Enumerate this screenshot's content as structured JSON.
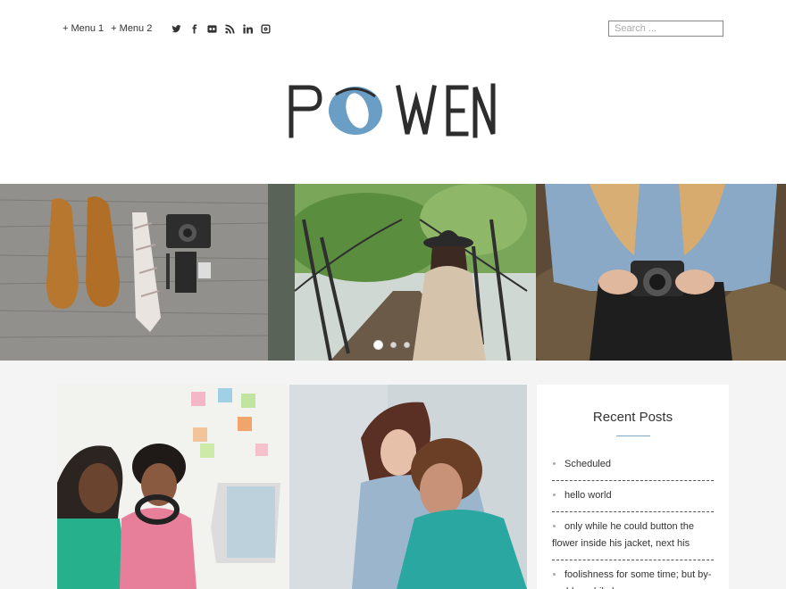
{
  "header": {
    "menu": [
      "+ Menu 1",
      "+ Menu 2"
    ],
    "social_icons": [
      "twitter-icon",
      "facebook-icon",
      "flickr-icon",
      "rss-icon",
      "linkedin-icon",
      "instagram-icon"
    ],
    "search_placeholder": "Search ...",
    "logo_text": "POWEN"
  },
  "slider": {
    "slides": [
      "shoes-tie-camera-photo",
      "woman-hat-stairs-photo",
      "woman-camera-photo"
    ],
    "active_slide": 1
  },
  "sidebar": {
    "title": "Recent Posts",
    "posts": [
      "Scheduled",
      "hello world",
      "only while he could button the flower inside his jacket, next his",
      "foolishness for some time; but by-and-by, while he"
    ]
  },
  "colors": {
    "logo_accent": "#6a9ec5",
    "logo_dark": "#2d2d2d",
    "rule": "#7fa7c4"
  }
}
